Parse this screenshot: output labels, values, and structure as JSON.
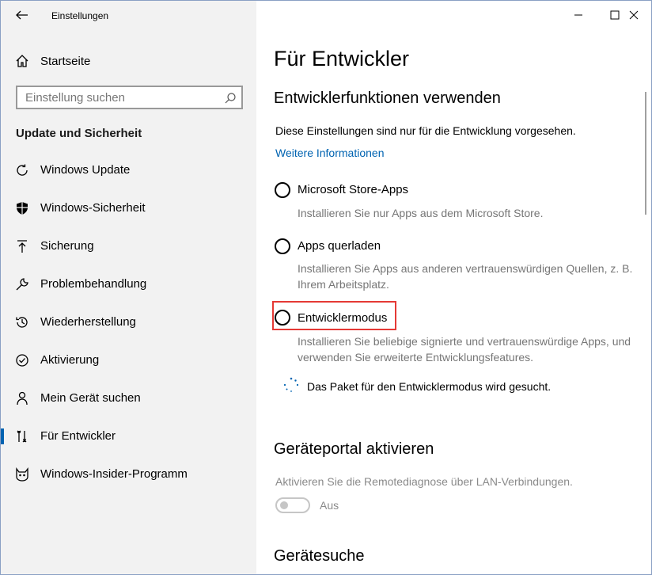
{
  "window": {
    "title": "Einstellungen",
    "back_icon": "arrow-left-icon",
    "controls": [
      "minimize-icon",
      "maximize-icon",
      "close-icon"
    ]
  },
  "sidebar": {
    "home_label": "Startseite",
    "search_placeholder": "Einstellung suchen",
    "section_title": "Update und Sicherheit",
    "items": [
      {
        "label": "Windows Update",
        "icon": "sync-icon"
      },
      {
        "label": "Windows-Sicherheit",
        "icon": "shield-icon"
      },
      {
        "label": "Sicherung",
        "icon": "upload-icon"
      },
      {
        "label": "Problembehandlung",
        "icon": "wrench-icon"
      },
      {
        "label": "Wiederherstellung",
        "icon": "history-icon"
      },
      {
        "label": "Aktivierung",
        "icon": "check-circle-icon"
      },
      {
        "label": "Mein Gerät suchen",
        "icon": "person-pin-icon"
      },
      {
        "label": "Für Entwickler",
        "icon": "developer-tools-icon",
        "active": true
      },
      {
        "label": "Windows-Insider-Programm",
        "icon": "insider-cat-icon"
      }
    ]
  },
  "main": {
    "page_title": "Für Entwickler",
    "dev_section": {
      "heading": "Entwicklerfunktionen verwenden",
      "description": "Diese Einstellungen sind nur für die Entwicklung vorgesehen.",
      "link": "Weitere Informationen",
      "options": [
        {
          "label": "Microsoft Store-Apps",
          "sub": "Installieren Sie nur Apps aus dem Microsoft Store."
        },
        {
          "label": "Apps querladen",
          "sub": "Installieren Sie Apps aus anderen vertrauenswürdigen Quellen, z. B. Ihrem Arbeitsplatz."
        },
        {
          "label": "Entwicklermodus",
          "sub": "Installieren Sie beliebige signierte und vertrauenswürdige Apps, und verwenden Sie erweiterte Entwicklungsfeatures."
        }
      ],
      "status": "Das Paket für den Entwicklermodus wird gesucht."
    },
    "portal_section": {
      "heading": "Geräteportal aktivieren",
      "description": "Aktivieren Sie die Remotediagnose über LAN-Verbindungen.",
      "toggle_state": "Aus"
    },
    "discovery_section": {
      "heading": "Gerätesuche"
    }
  },
  "colors": {
    "accent": "#0063b1",
    "highlight_border": "#e53935",
    "sidebar_bg": "#f2f2f2"
  }
}
